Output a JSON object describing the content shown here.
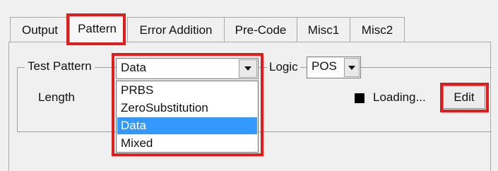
{
  "tabs": [
    {
      "label": "Output",
      "selected": false
    },
    {
      "label": "Pattern",
      "selected": true
    },
    {
      "label": "Error Addition",
      "selected": false
    },
    {
      "label": "Pre-Code",
      "selected": false
    },
    {
      "label": "Misc1",
      "selected": false
    },
    {
      "label": "Misc2",
      "selected": false
    }
  ],
  "pattern_panel": {
    "group_label": "Test Pattern",
    "test_pattern_combo": {
      "value": "Data",
      "options": [
        "PRBS",
        "ZeroSubstitution",
        "Data",
        "Mixed"
      ],
      "selected_index": 2,
      "expanded": true
    },
    "logic_label": "Logic",
    "logic_combo": {
      "value": "POS"
    },
    "length_label": "Length",
    "loading_text": "Loading...",
    "edit_button": "Edit"
  },
  "colors": {
    "highlight": "#e31b1b",
    "selection": "#3399ff",
    "window_bg": "#f0f0f0",
    "indicator": "#000000"
  },
  "icons": [
    "combo-dropdown-arrow-icon",
    "loading-indicator-square"
  ]
}
